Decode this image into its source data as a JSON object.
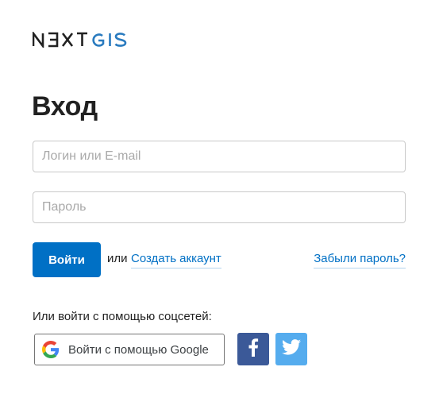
{
  "brand": {
    "logo_prefix": "NEXT",
    "logo_suffix": "GIS",
    "colors": {
      "dark": "#212121",
      "blue": "#2a7bbf"
    }
  },
  "page": {
    "title": "Вход"
  },
  "form": {
    "login_placeholder": "Логин или E-mail",
    "login_value": "",
    "password_placeholder": "Пароль",
    "password_value": "",
    "submit_label": "Войти",
    "or_text": "или",
    "register_link": "Создать аккаунт",
    "forgot_link": "Забыли пароль?"
  },
  "social": {
    "caption": "Или войти с помощью соцсетей:",
    "google_label": "Войти с помощью Google",
    "google_icon": "google-icon",
    "facebook_icon": "facebook-icon",
    "twitter_icon": "twitter-icon",
    "colors": {
      "facebook": "#3b5998",
      "twitter": "#55acee"
    }
  },
  "colors": {
    "accent": "#0070c5",
    "text": "#212121",
    "border": "#c9c9c9"
  }
}
